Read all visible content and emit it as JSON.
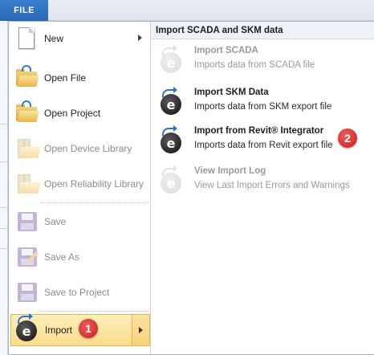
{
  "ribbon": {
    "file_tab": "FILE"
  },
  "menu": {
    "items": [
      {
        "label": "New",
        "icon": "new-document-icon",
        "enabled": true,
        "submenu": true
      },
      {
        "label": "Open File",
        "icon": "open-folder-icon",
        "enabled": true
      },
      {
        "label": "Open Project",
        "icon": "open-project-icon",
        "enabled": true
      },
      {
        "label": "Open Device Library",
        "icon": "device-library-icon",
        "enabled": false
      },
      {
        "label": "Open Reliability Library",
        "icon": "reliability-library-icon",
        "enabled": false
      },
      {
        "label": "Save",
        "icon": "save-disk-icon",
        "enabled": false
      },
      {
        "label": "Save As",
        "icon": "save-as-icon",
        "enabled": false
      },
      {
        "label": "Save to Project",
        "icon": "save-to-project-icon",
        "enabled": false
      },
      {
        "label": "Import",
        "icon": "import-icon",
        "enabled": true,
        "submenu": true,
        "active": true
      }
    ]
  },
  "submenu": {
    "header": "Import SCADA and SKM data",
    "items": [
      {
        "title": "Import SCADA",
        "description": "Imports data from SCADA file",
        "enabled": false
      },
      {
        "title": "Import SKM Data",
        "description": "Imports data from SKM export file",
        "enabled": true
      },
      {
        "title": "Import from Revit® Integrator",
        "description": "Imports data from Revit export file",
        "enabled": true
      },
      {
        "title": "View Import Log",
        "description": "View Last Import Errors and Warnings",
        "enabled": false
      }
    ]
  },
  "annotations": {
    "badge_1": "1",
    "badge_2": "2"
  },
  "colors": {
    "accent": "#2a66b4",
    "hover": "#fbdc8a",
    "badge": "#d42a2a"
  }
}
